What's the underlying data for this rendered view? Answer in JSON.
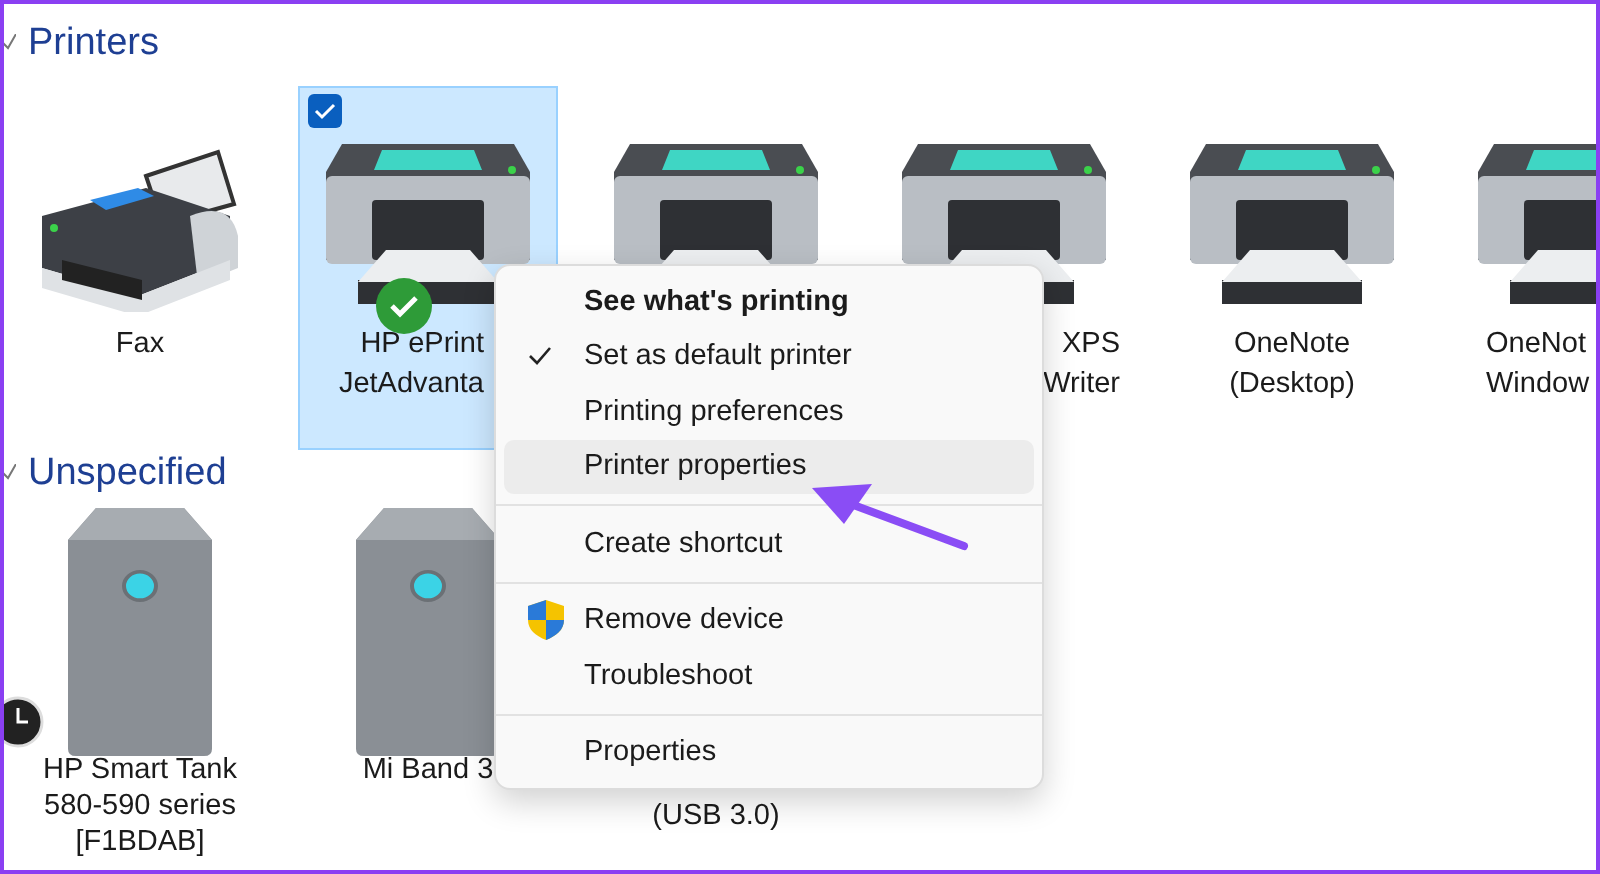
{
  "sections": [
    {
      "title": "Printers",
      "expanded": true,
      "devices": [
        {
          "kind": "fax",
          "lines": [
            "Fax"
          ],
          "selected": false,
          "default": false,
          "pending": false
        },
        {
          "kind": "printer",
          "lines": [
            "HP ePrint",
            "JetAdvanta"
          ],
          "selected": true,
          "default": true,
          "pending": false
        },
        {
          "kind": "printer",
          "selected": false,
          "default": false,
          "pending": false
        },
        {
          "kind": "printer",
          "lines": [
            "XPS",
            "Writer"
          ],
          "selected": false,
          "default": false,
          "pending": false
        },
        {
          "kind": "printer",
          "lines": [
            "OneNote",
            "(Desktop)"
          ],
          "selected": false,
          "default": false,
          "pending": false
        },
        {
          "kind": "printer",
          "lines": [
            "OneNot",
            "Window"
          ],
          "selected": false,
          "default": false,
          "pending": false
        }
      ]
    },
    {
      "title": "Unspecified",
      "expanded": true,
      "devices": [
        {
          "kind": "drive",
          "lines": [
            "HP Smart Tank",
            "580-590 series",
            "[F1BDAB]"
          ],
          "selected": false,
          "default": false,
          "pending": true
        },
        {
          "kind": "drive",
          "lines": [
            "Mi Band 3"
          ],
          "selected": false,
          "default": false,
          "pending": false
        },
        {
          "kind": "covered",
          "lines": [
            "(USB 3.0)"
          ],
          "selected": false,
          "default": false,
          "pending": false
        }
      ]
    }
  ],
  "menu": [
    {
      "kind": "item",
      "label": "See what's printing",
      "bold": true,
      "checked": false,
      "selected": false
    },
    {
      "kind": "item",
      "label": "Set as default printer",
      "bold": false,
      "checked": true,
      "selected": false
    },
    {
      "kind": "item",
      "label": "Printing preferences",
      "bold": false,
      "checked": false,
      "selected": false
    },
    {
      "kind": "item",
      "label": "Printer properties",
      "bold": false,
      "checked": false,
      "selected": true
    },
    {
      "kind": "separator"
    },
    {
      "kind": "item",
      "label": "Create shortcut",
      "bold": false,
      "checked": false,
      "selected": false
    },
    {
      "kind": "separator"
    },
    {
      "kind": "admin",
      "label": "Remove device",
      "bold": false,
      "checked": false,
      "selected": false
    },
    {
      "kind": "item",
      "label": "Troubleshoot",
      "bold": false,
      "checked": false,
      "selected": false
    },
    {
      "kind": "separator"
    },
    {
      "kind": "item",
      "label": "Properties",
      "bold": false,
      "checked": false,
      "selected": false
    }
  ]
}
